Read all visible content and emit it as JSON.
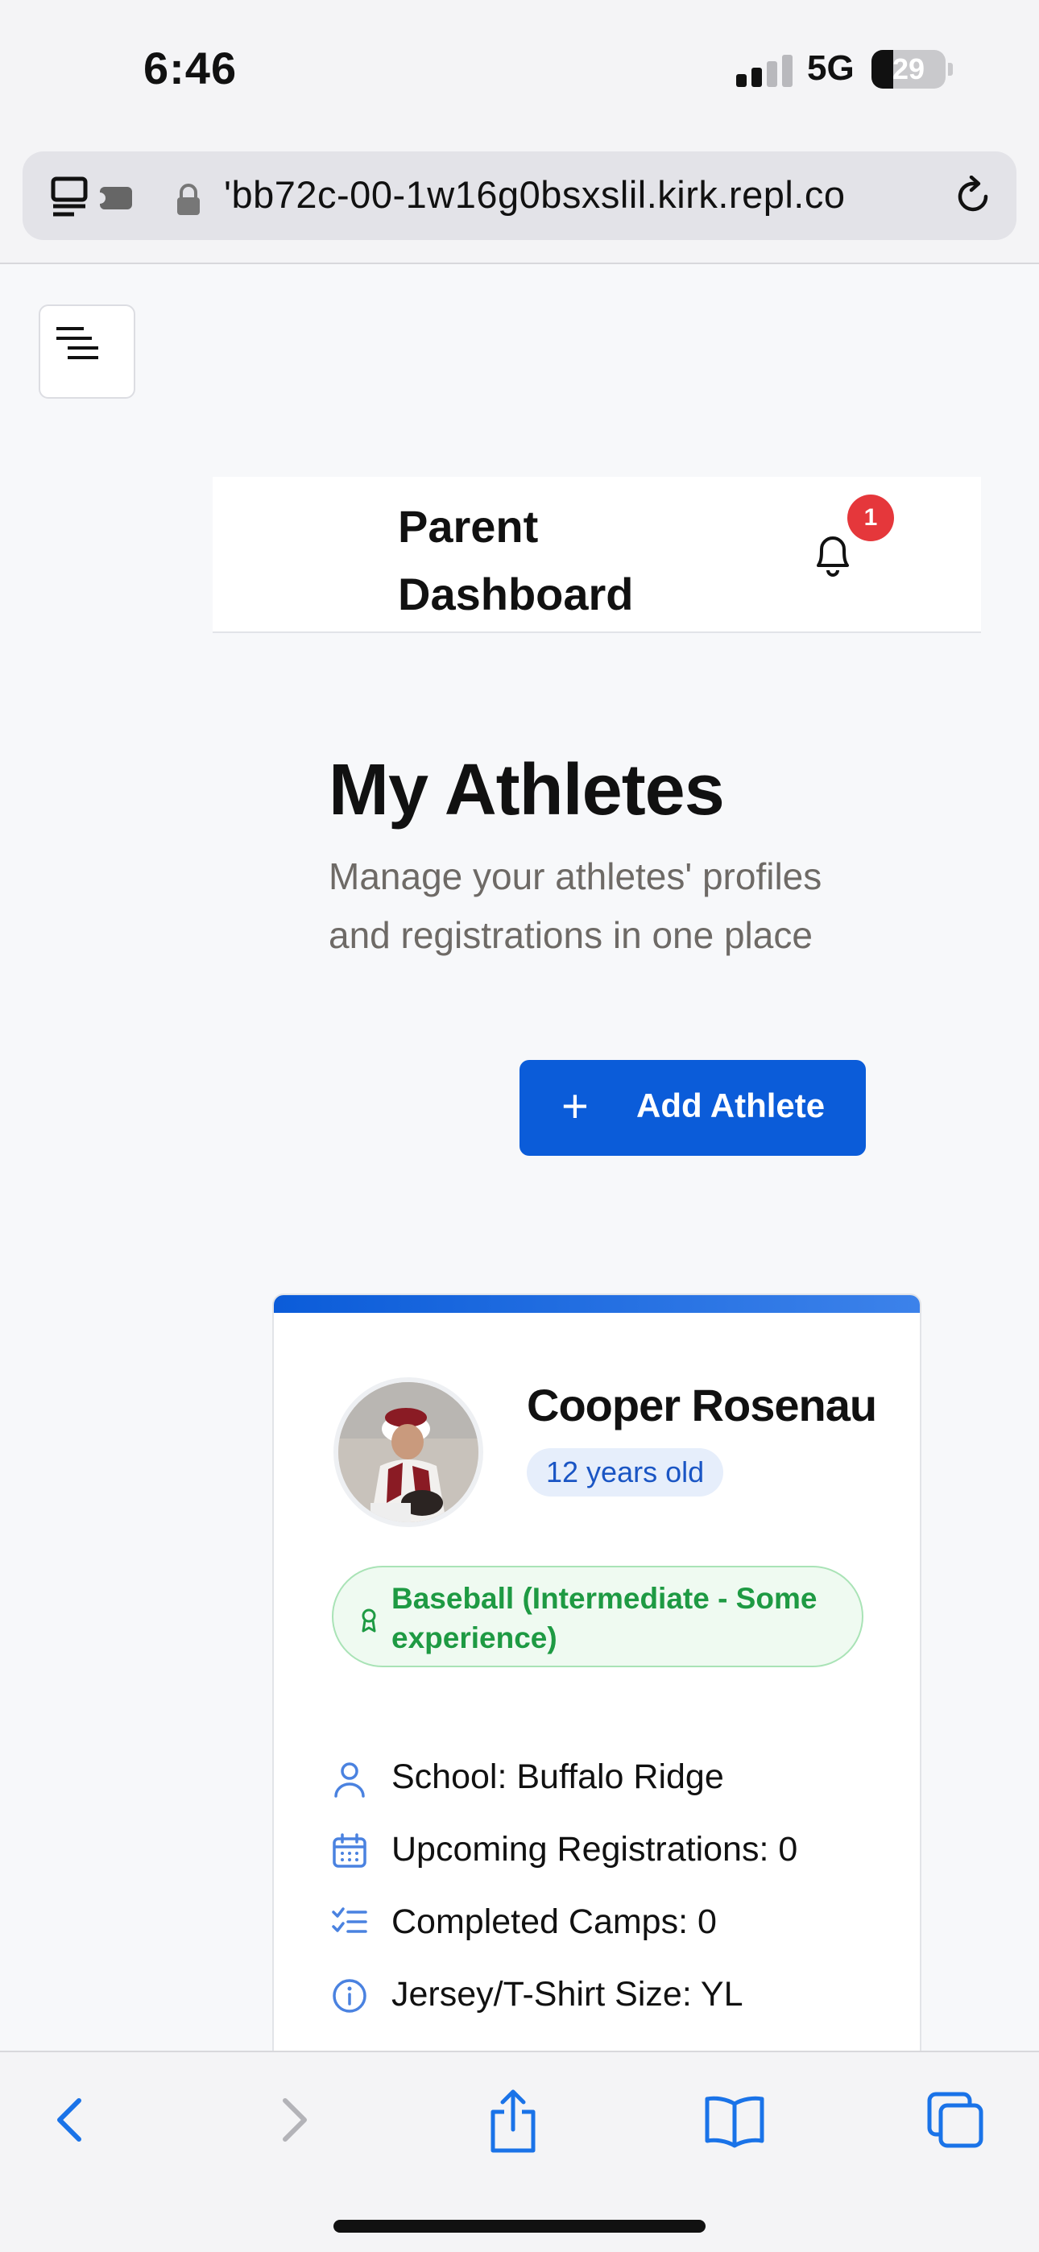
{
  "status_bar": {
    "time": "6:46",
    "network": "5G",
    "battery_level": "29",
    "battery_fraction": 0.29
  },
  "browser": {
    "url": "'bb72c-00-1w16g0bsxslil.kirk.repl.co"
  },
  "header": {
    "title": "Parent Dashboard",
    "notification_count": "1"
  },
  "main": {
    "title": "My Athletes",
    "subtitle": "Manage your athletes' profiles and registrations in one place",
    "add_button": {
      "icon": "+",
      "label": "Add Athlete"
    }
  },
  "athlete": {
    "name": "Cooper Rosenau",
    "age": "12 years old",
    "sport": "Baseball (Intermediate - Some experience)",
    "details": [
      {
        "icon": "person-icon",
        "text": "School: Buffalo Ridge"
      },
      {
        "icon": "calendar-icon",
        "text": "Upcoming Registrations: 0"
      },
      {
        "icon": "checklist-icon",
        "text": "Completed Camps: 0"
      },
      {
        "icon": "info-icon",
        "text": "Jersey/T-Shirt Size: YL"
      }
    ]
  },
  "colors": {
    "primary": "#0b5cd9",
    "badge": "#e5373b",
    "sport_green": "#1e9a43",
    "age_blue": "#1a55c4",
    "safari_blue": "#1a73e8"
  }
}
